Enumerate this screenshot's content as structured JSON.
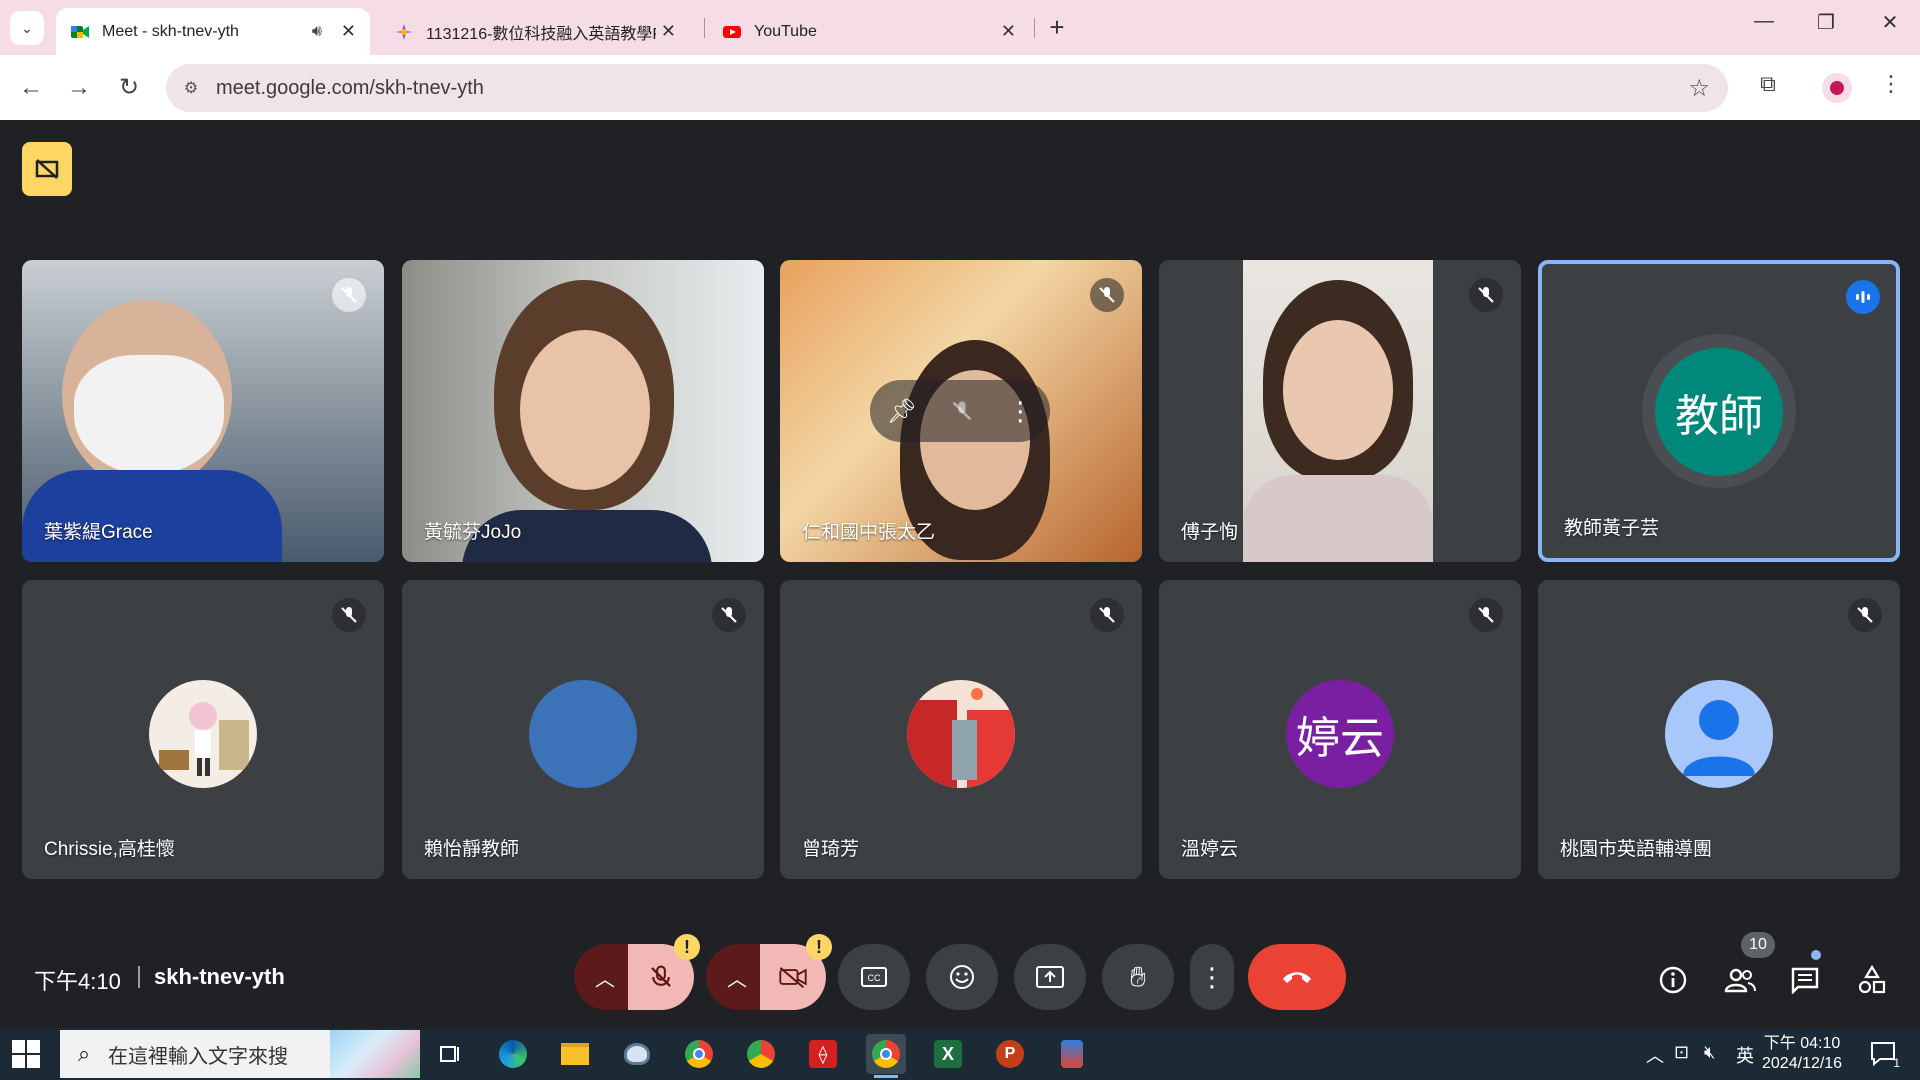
{
  "browser": {
    "tabs": [
      {
        "title": "Meet - skh-tnev-yth",
        "active": true
      },
      {
        "title": "1131216-數位科技融入英語教學P",
        "active": false
      },
      {
        "title": "YouTube",
        "active": false
      }
    ],
    "address": "meet.google.com/skh-tnev-yth"
  },
  "participants": [
    {
      "name": "葉紫緹Grace",
      "muted": true,
      "video": true
    },
    {
      "name": "黃毓芬JoJo",
      "muted": false,
      "video": true
    },
    {
      "name": "仁和國中張太乙",
      "muted": true,
      "video": true
    },
    {
      "name": "傅子恂",
      "muted": true,
      "video": true
    },
    {
      "name": "教師黃子芸",
      "speaking": true,
      "avatar_text": "教師",
      "avatar_color": "#00897b"
    },
    {
      "name": "Chrissie,高桂懷",
      "muted": true,
      "avatar_image": "cartoon-girl"
    },
    {
      "name": "賴怡靜教師",
      "muted": true,
      "avatar_color": "#3b72b8"
    },
    {
      "name": "曾琦芳",
      "muted": true,
      "avatar_image": "red-illustration"
    },
    {
      "name": "溫婷云",
      "muted": true,
      "avatar_text": "婷云",
      "avatar_color": "#7b1fa2"
    },
    {
      "name": "桃園市英語輔導團",
      "muted": true,
      "avatar_image": "default-person",
      "avatar_color": "#a8c7fa"
    }
  ],
  "meeting": {
    "time": "下午4:10",
    "code": "skh-tnev-yth",
    "people_count": "10"
  },
  "taskbar": {
    "search_placeholder": "在這裡輸入文字來搜",
    "ime": "英",
    "clock_time": "下午 04:10",
    "clock_date": "2024/12/16",
    "notification_count": "1"
  },
  "colors": {
    "tabbar": "#f6dce7",
    "meet_bg": "#202124",
    "tile_bg": "#3c4043",
    "hangup": "#ea4335",
    "speaking_border": "#8ab4f8"
  }
}
